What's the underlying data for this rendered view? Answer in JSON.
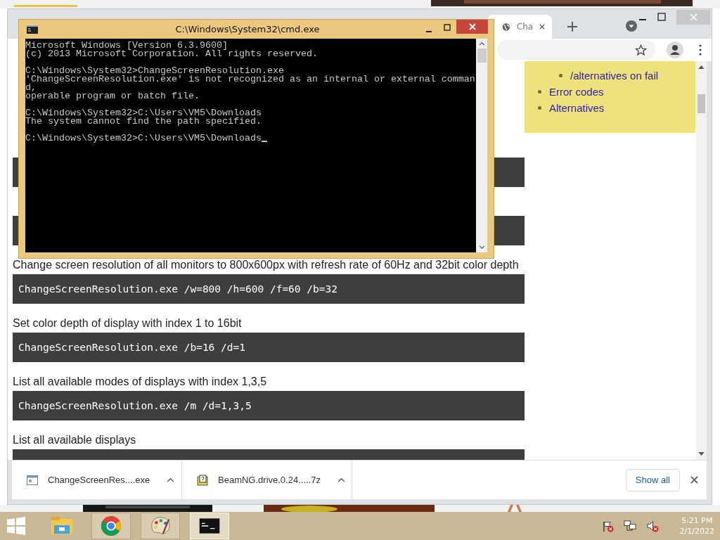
{
  "chrome": {
    "tab": {
      "title": "Cha"
    },
    "page": {
      "sections": [
        {
          "text": "Change screen resolution of all monitors to 800x600px with refresh rate of 60Hz and 32bit color depth",
          "code": "ChangeScreenResolution.exe /w=800 /h=600 /f=60 /b=32"
        },
        {
          "text": "Set color depth of display with index 1 to 16bit",
          "code": "ChangeScreenResolution.exe /b=16 /d=1"
        },
        {
          "text": "List all available modes of displays with index 1,3,5",
          "code": "ChangeScreenResolution.exe /m /d=1,3,5"
        },
        {
          "text": "List all available displays"
        }
      ]
    },
    "toc": {
      "items": [
        {
          "children": [
            {
              "label": "/alternatives on fail"
            }
          ]
        },
        {
          "label": "Error codes"
        },
        {
          "label": "Alternatives"
        }
      ]
    },
    "downloads": [
      {
        "name": "ChangeScreenRes....exe",
        "kind": "app"
      },
      {
        "name": "BeamNG.drive.0.24.....7z",
        "kind": "archive"
      }
    ],
    "show_all": "Show all"
  },
  "cmd": {
    "title": "C:\\Windows\\System32\\cmd.exe",
    "blocks": [
      [
        "Microsoft Windows [Version 6.3.9600]",
        "(c) 2013 Microsoft Corporation. All rights reserved."
      ],
      [
        "C:\\Windows\\System32>ChangeScreenResolution.exe",
        "'ChangeScreenResolution.exe' is not recognized as an internal or external comman",
        "d,",
        "operable program or batch file."
      ],
      [
        "C:\\Windows\\System32>C:\\Users\\VM5\\Downloads",
        "The system cannot find the path specified."
      ],
      [
        "C:\\Windows\\System32>C:\\Users\\VM5\\Downloads"
      ]
    ]
  },
  "taskbar": {
    "apps": [
      {
        "kind": "explorer",
        "running": false,
        "active": false
      },
      {
        "kind": "chrome",
        "running": true,
        "active": false
      },
      {
        "kind": "paint",
        "running": true,
        "active": false
      },
      {
        "kind": "cmd",
        "running": true,
        "active": true
      }
    ],
    "clock": {
      "time": "5:21 PM",
      "date": "2/1/2022"
    }
  }
}
